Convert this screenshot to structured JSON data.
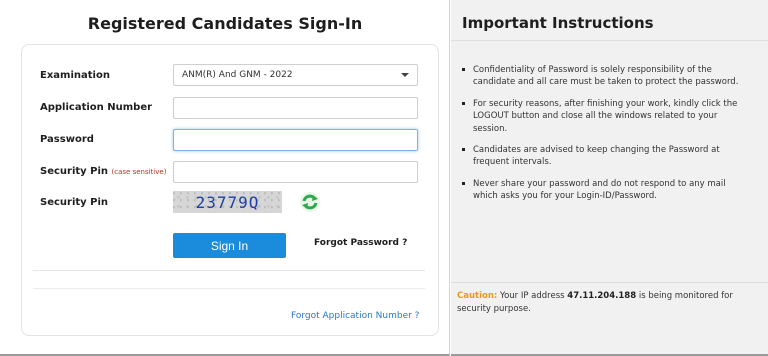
{
  "signin": {
    "title": "Registered Candidates Sign-In",
    "examination_label": "Examination",
    "examination_value": "ANM(R) And GNM - 2022",
    "application_number_label": "Application Number",
    "application_number_value": "",
    "password_label": "Password",
    "password_value": "",
    "security_pin_input_label": "Security Pin",
    "security_pin_hint": "(case sensitive)",
    "security_pin_input_value": "",
    "security_pin_captcha_label": "Security Pin",
    "captcha_text": "23779Q",
    "signin_button": "Sign In",
    "forgot_password": "Forgot Password ?",
    "forgot_application_number": "Forgot Application Number ?"
  },
  "instructions": {
    "title": "Important Instructions",
    "items": [
      "Confidentiality of Password is solely responsibility of the candidate and all care must be taken to protect the password.",
      "For security reasons, after finishing your work, kindly click the LOGOUT button and close all the windows related to your session.",
      "Candidates are advised to keep changing the Password at frequent intervals.",
      "Never share your password and do not respond to any mail which asks you for your Login-ID/Password."
    ],
    "caution_label": "Caution:",
    "caution_prefix": "Your IP address",
    "ip_address": "47.11.204.188",
    "caution_suffix": "is being monitored for security purpose."
  },
  "colors": {
    "accent": "#1a8cdb",
    "link": "#2a78c9",
    "caution": "#e89a16",
    "hint": "#b0341d",
    "captcha_text": "#1d3fa6",
    "refresh_icon": "#2fa84a"
  },
  "icons": {
    "dropdown": "chevron-down-icon",
    "refresh": "refresh-icon"
  }
}
